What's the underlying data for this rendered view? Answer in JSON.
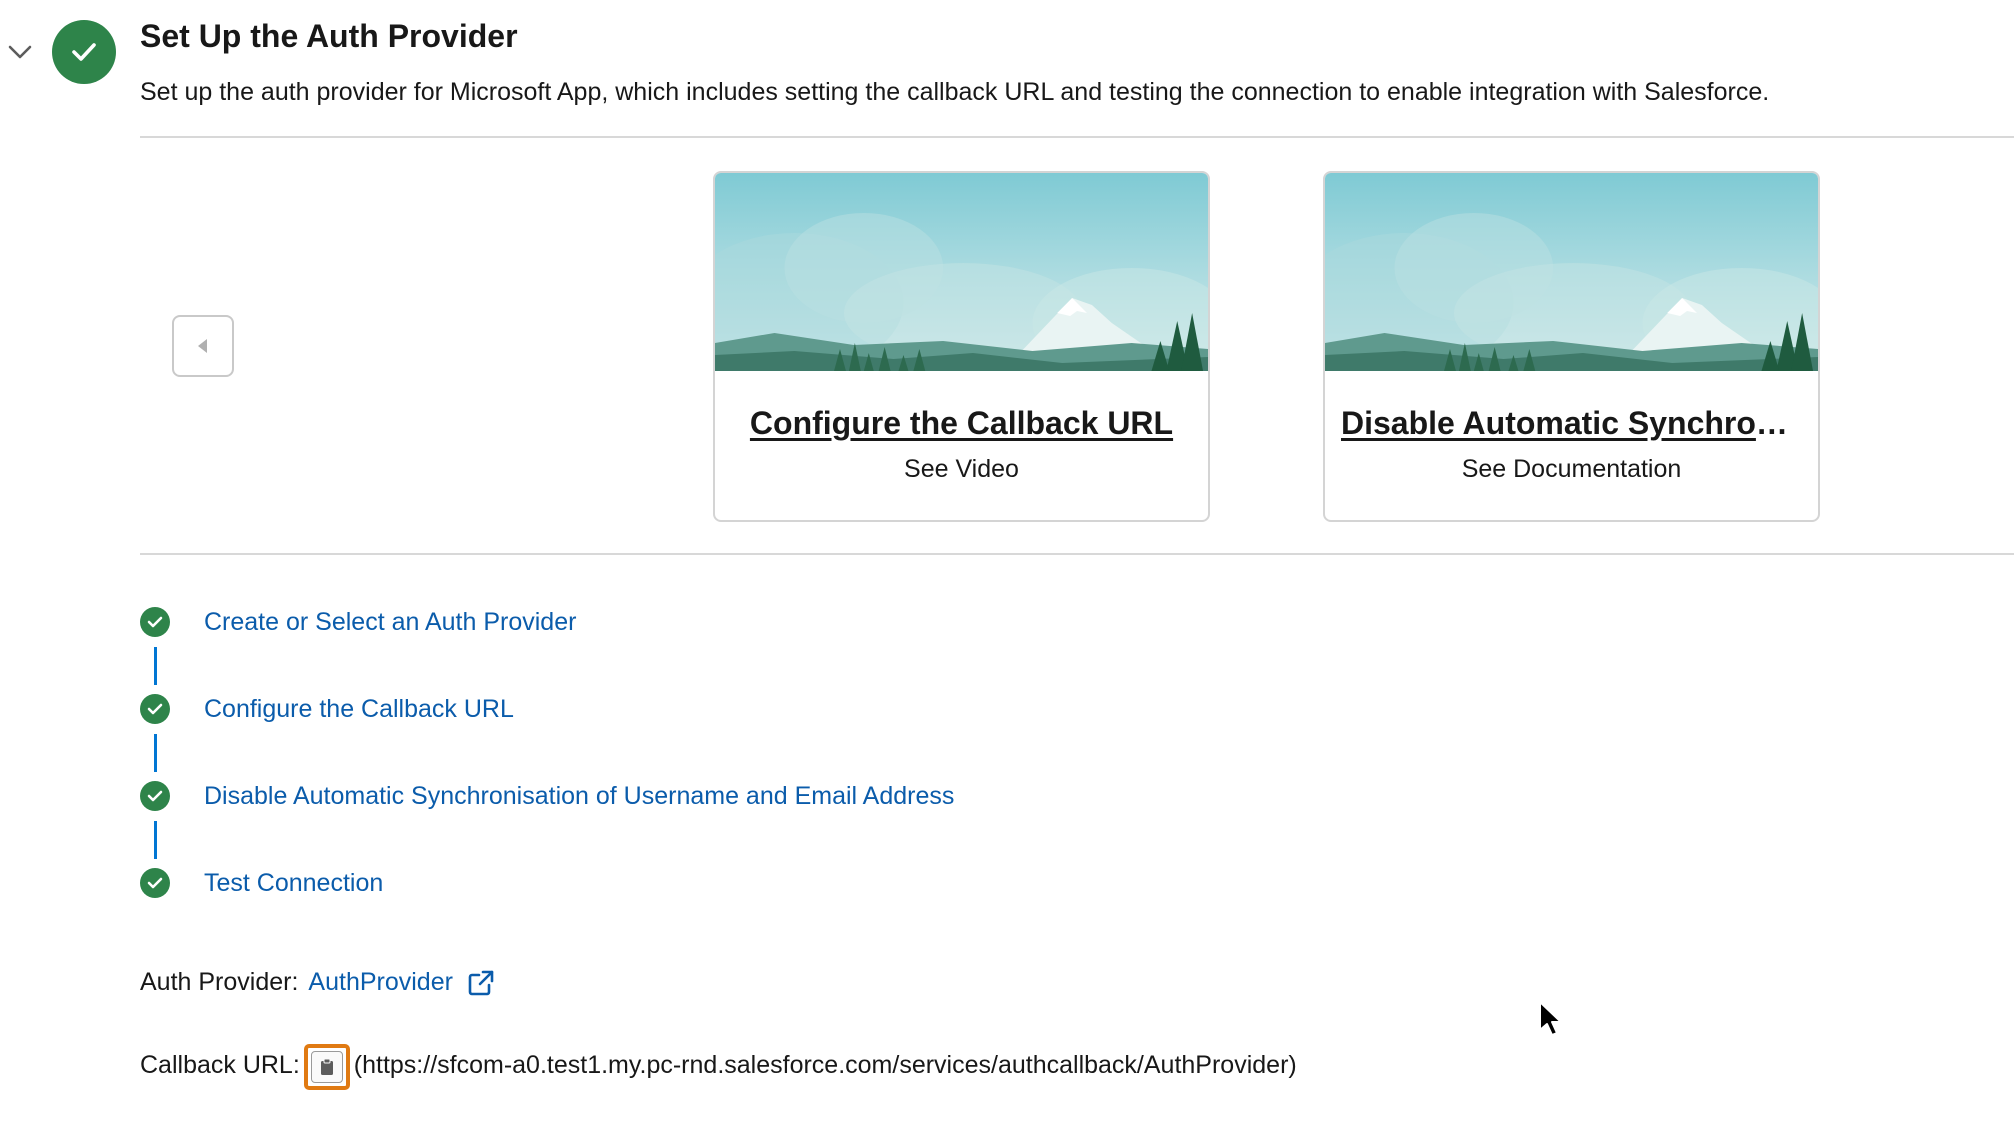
{
  "section": {
    "title": "Set Up the Auth Provider",
    "description": "Set up the auth provider for Microsoft App, which includes setting the callback URL and testing the connection to enable integration with Salesforce.",
    "status": "complete"
  },
  "carousel": {
    "cards": [
      {
        "title": "Configure the Callback URL",
        "subtitle": "See Video"
      },
      {
        "title": "Disable Automatic Synchron...",
        "subtitle": "See Documentation"
      }
    ]
  },
  "steps": [
    {
      "label": "Create or Select an Auth Provider",
      "status": "complete"
    },
    {
      "label": "Configure the Callback URL",
      "status": "complete"
    },
    {
      "label": "Disable Automatic Synchronisation of Username and Email Address",
      "status": "complete"
    },
    {
      "label": "Test Connection",
      "status": "complete"
    }
  ],
  "auth_provider": {
    "label": "Auth Provider:",
    "value": "AuthProvider"
  },
  "callback": {
    "label": "Callback URL:",
    "value": "(https://sfcom-a0.test1.my.pc-rnd.salesforce.com/services/authcallback/AuthProvider)"
  },
  "colors": {
    "success_green": "#2e844a",
    "link_blue": "#0b5cab",
    "connector_blue": "#0176d3",
    "highlight_orange": "#e07a12"
  },
  "icons": {
    "collapse": "chevron-down-icon",
    "status": "check-icon",
    "carousel_prev": "caret-left-icon",
    "external": "external-link-icon",
    "copy": "clipboard-icon"
  }
}
